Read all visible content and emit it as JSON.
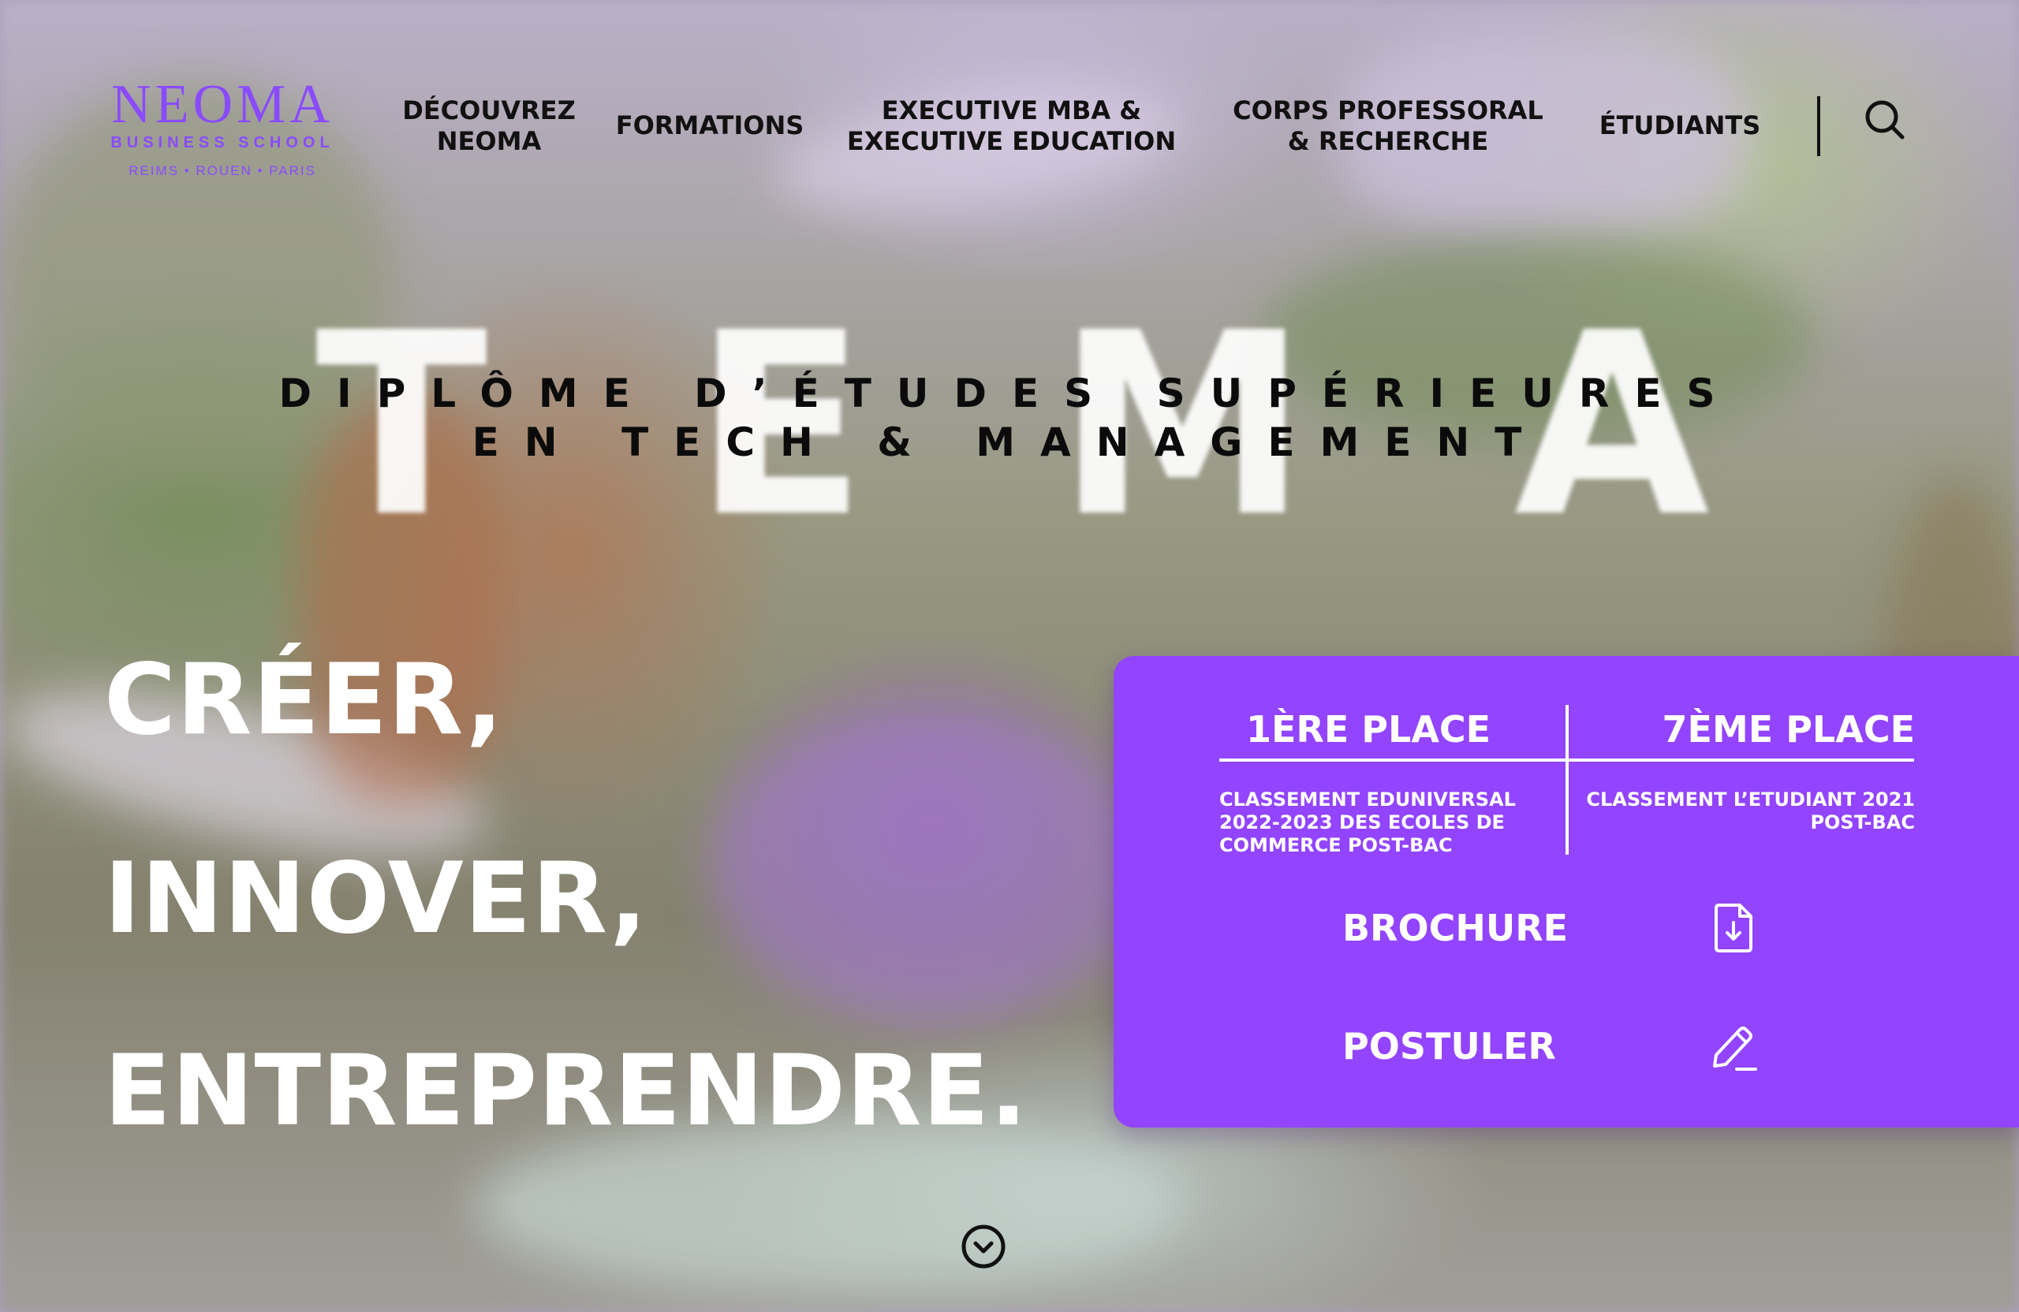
{
  "logo": {
    "name": "NEOMA",
    "subtitle": "BUSINESS SCHOOL",
    "cities": "REIMS • ROUEN • PARIS"
  },
  "nav": {
    "discover": "DÉCOUVREZ\nNEOMA",
    "formations": "FORMATIONS",
    "executive": "EXECUTIVE MBA &\nEXECUTIVE EDUCATION",
    "faculty": "CORPS PROFESSORAL\n& RECHERCHE",
    "students": "ÉTUDIANTS"
  },
  "icons": {
    "search": "search-icon",
    "brochure": "file-download-icon",
    "apply": "pencil-icon",
    "scroll": "chevron-down-circle-icon"
  },
  "hero": {
    "big_letters": [
      "T",
      "E",
      "M",
      "A"
    ],
    "diploma_line1": "DIPLÔME D’ÉTUDES SUPÉRIEURES",
    "diploma_line2": "EN TECH & MANAGEMENT",
    "line1": "CRÉER,",
    "line2": "INNOVER,",
    "line3": "ENTREPRENDRE."
  },
  "panel": {
    "rank1_title": "1ÈRE PLACE",
    "rank1_desc": "CLASSEMENT EDUNIVERSAL 2022-2023 DES ECOLES DE COMMERCE POST-BAC",
    "rank2_title": "7ÈME PLACE",
    "rank2_desc": "CLASSEMENT L’ETUDIANT 2021 POST-BAC",
    "brochure": "BROCHURE",
    "apply": "POSTULER"
  },
  "colors": {
    "brand_purple": "#9244ff",
    "logo_purple": "#8a4bff",
    "text_dark": "#111111",
    "white": "#ffffff"
  }
}
